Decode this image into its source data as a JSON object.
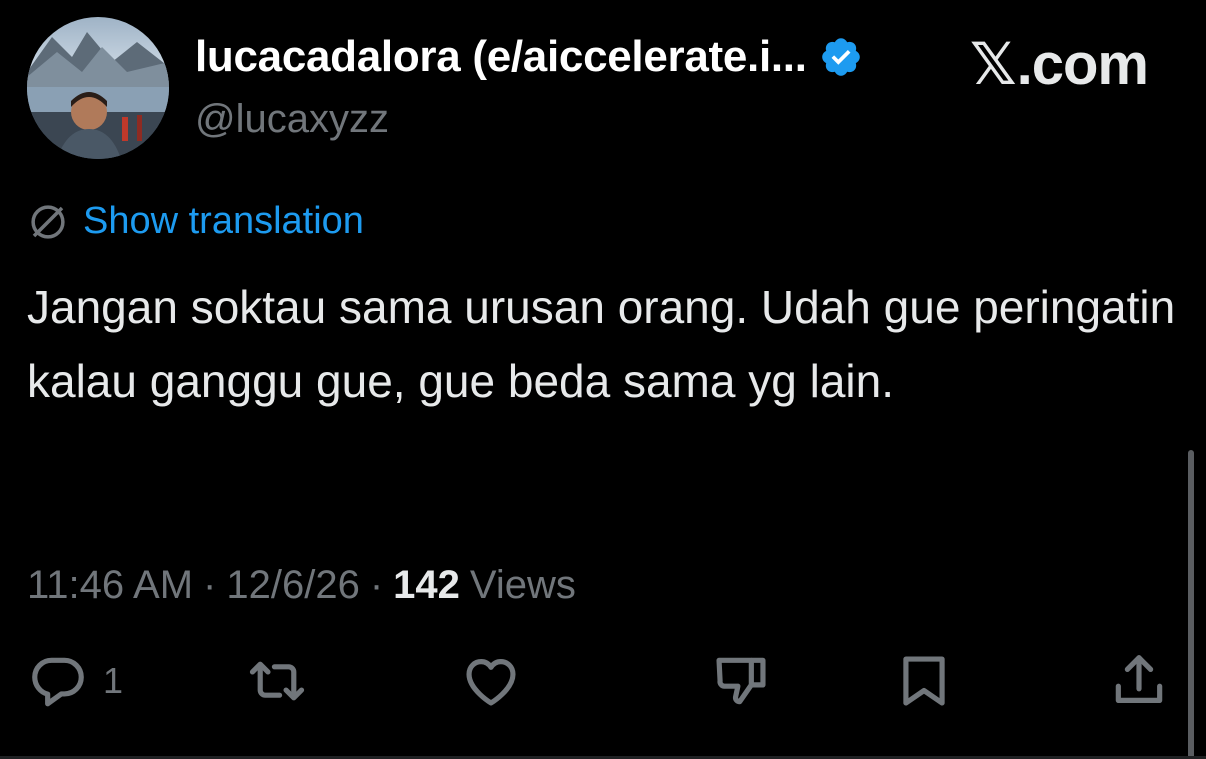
{
  "user": {
    "display_name": "lucacadalora (e/aiccelerate.i...",
    "handle": "@lucaxyzz",
    "verified": true
  },
  "brand": {
    "x_mark": "𝕏",
    "domain": ".com"
  },
  "translate": {
    "icon": "globe-icon",
    "label": "Show translation"
  },
  "tweet": {
    "text": "Jangan soktau sama urusan orang. Udah gue peringatin kalau ganggu gue, gue beda sama yg lain."
  },
  "meta": {
    "time": "11:46 AM",
    "separator": "·",
    "date": "12/6/26",
    "views_count": "142",
    "views_label": "Views"
  },
  "actions": {
    "reply": {
      "icon": "reply-icon",
      "count": "1"
    },
    "retweet": {
      "icon": "retweet-icon"
    },
    "like": {
      "icon": "heart-icon"
    },
    "dislike": {
      "icon": "thumbs-down-icon"
    },
    "bookmark": {
      "icon": "bookmark-icon"
    },
    "share": {
      "icon": "share-icon"
    }
  },
  "colors": {
    "background": "#000000",
    "text": "#e7e9ea",
    "muted": "#71767b",
    "link": "#1d9bf0",
    "verified": "#1d9bf0"
  }
}
